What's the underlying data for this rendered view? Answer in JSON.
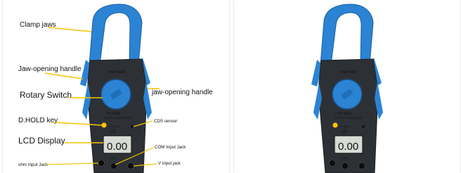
{
  "annotations": {
    "clamp_jaws": "Clamp jaws",
    "jaw_opening_handle_left": "Jaw-opening handle",
    "jaw_opening_handle_right": "jaw-opening handle",
    "rotary_switch": "Rotary Switch",
    "dhold_key": "D.HOLD key",
    "cds_sensor": "CDS sensor",
    "lcd_display": "LCD Display",
    "com_input_jack": "COM Input Jack",
    "ohm_input_jack": "ohm Input Jack",
    "v_input_jack": "V input jack"
  },
  "device": {
    "brand": "HoldPeak®",
    "model": "HP-6208",
    "subtitle": "DIGITAL CLAMP METER",
    "certification": "CE",
    "display_value": "0.00",
    "hold_key_text": "D.HOLD",
    "jack_com": "COM"
  },
  "colors": {
    "jaw": "#2b83d4",
    "body": "#2d3136",
    "led": "#f6c400",
    "display_bg": "#d7dbd3"
  }
}
